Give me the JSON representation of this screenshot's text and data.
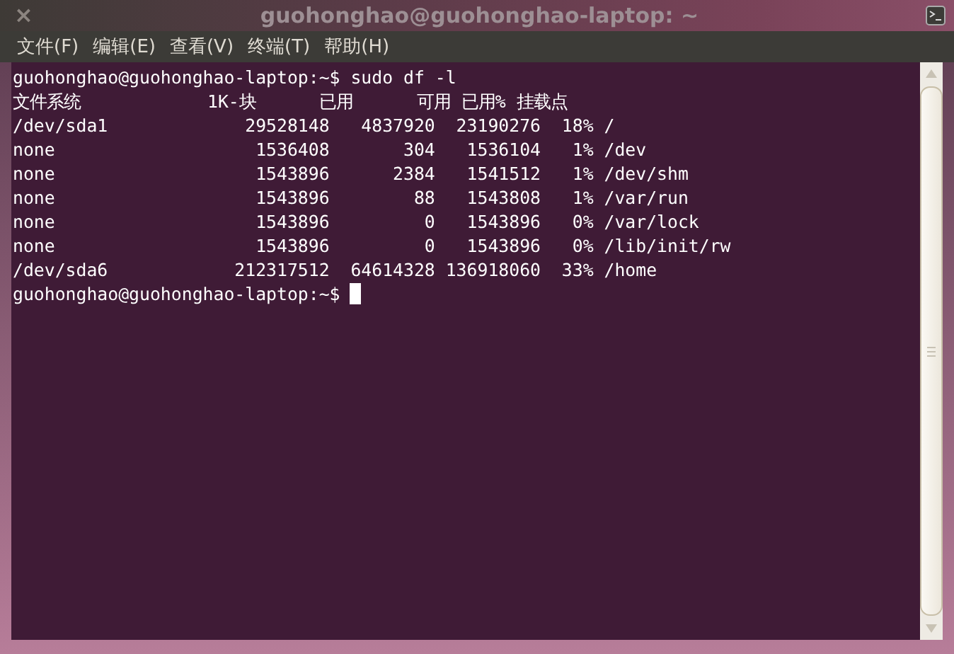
{
  "window": {
    "title": "guohonghao@guohonghao-laptop: ~",
    "close": "×"
  },
  "menu": [
    "文件(F)",
    "编辑(E)",
    "查看(V)",
    "终端(T)",
    "帮助(H)"
  ],
  "terminal": {
    "lines": [
      "guohonghao@guohonghao-laptop:~$ sudo df -l",
      "文件系统            1K-块      已用      可用 已用% 挂载点",
      "/dev/sda1             29528148   4837920  23190276  18% /",
      "none                   1536408       304   1536104   1% /dev",
      "none                   1543896      2384   1541512   1% /dev/shm",
      "none                   1543896        88   1543808   1% /var/run",
      "none                   1543896         0   1543896   0% /var/lock",
      "none                   1543896         0   1543896   0% /lib/init/rw",
      "/dev/sda6            212317512  64614328 136918060  33% /home",
      "guohonghao@guohonghao-laptop:~$"
    ],
    "cursor": true
  }
}
